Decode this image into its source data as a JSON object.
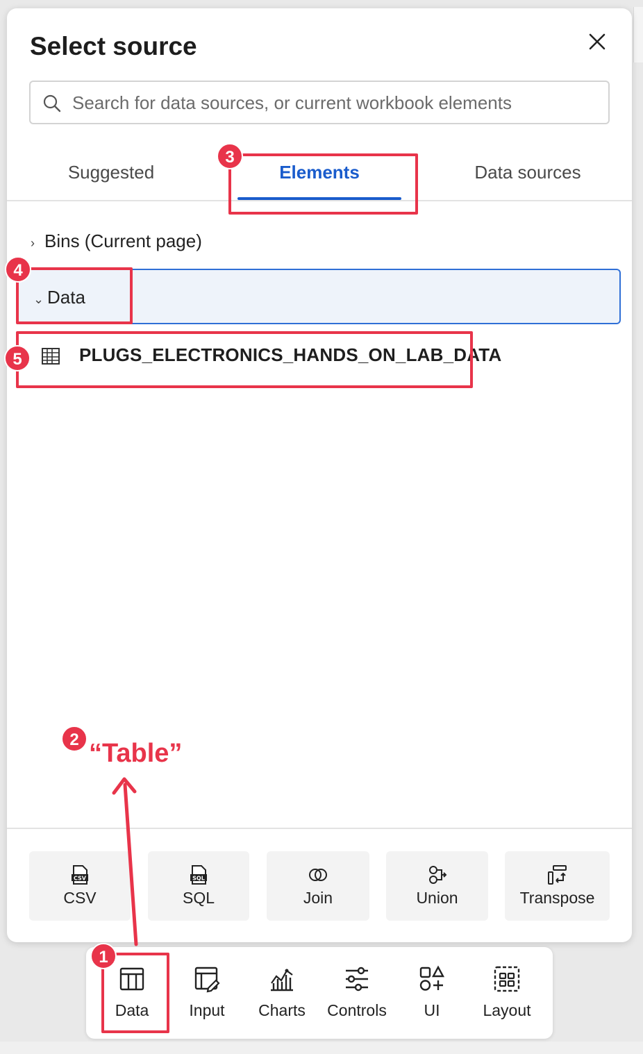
{
  "panel": {
    "title": "Select source",
    "close_icon": "close-icon"
  },
  "search": {
    "placeholder": "Search for data sources, or current workbook elements",
    "value": ""
  },
  "tabs": [
    {
      "label": "Suggested",
      "active": false
    },
    {
      "label": "Elements",
      "active": true
    },
    {
      "label": "Data sources",
      "active": false
    }
  ],
  "tree": {
    "bins_label": "Bins (Current page)",
    "data_label": "Data",
    "table_item": "PLUGS_ELECTRONICS_HANDS_ON_LAB_DATA"
  },
  "tools": [
    {
      "label": "CSV",
      "icon": "csv-icon"
    },
    {
      "label": "SQL",
      "icon": "sql-icon"
    },
    {
      "label": "Join",
      "icon": "join-icon"
    },
    {
      "label": "Union",
      "icon": "union-icon"
    },
    {
      "label": "Transpose",
      "icon": "transpose-icon"
    }
  ],
  "dock": [
    {
      "label": "Data",
      "icon": "table-icon"
    },
    {
      "label": "Input",
      "icon": "input-icon"
    },
    {
      "label": "Charts",
      "icon": "charts-icon"
    },
    {
      "label": "Controls",
      "icon": "controls-icon"
    },
    {
      "label": "UI",
      "icon": "ui-icon"
    },
    {
      "label": "Layout",
      "icon": "layout-icon"
    }
  ],
  "annotations": {
    "badges": [
      "1",
      "2",
      "3",
      "4",
      "5"
    ],
    "callout": "“Table”",
    "accent_color": "#e8344a"
  },
  "colors": {
    "active_tab": "#1a5ccc",
    "selected_row_bg": "#eef3fa",
    "selected_row_border": "#2f6fd6"
  }
}
